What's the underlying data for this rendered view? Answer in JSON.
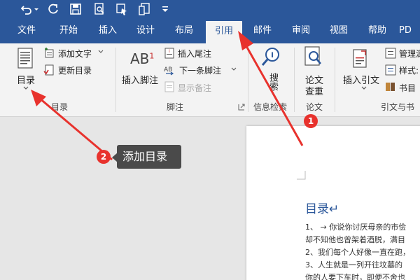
{
  "colors": {
    "ribbon_blue": "#2b579a",
    "ribbon_bg": "#f3f3f3",
    "arrow_red": "#e8322d",
    "tooltip_bg": "#4a4a4a"
  },
  "quick_access": {
    "icons": [
      "undo-icon",
      "dropdown-arrow-icon",
      "redo-icon",
      "save-icon",
      "print-preview-icon",
      "touch-mode-icon",
      "format-icon",
      "customize-icon"
    ]
  },
  "tabs": [
    {
      "label": "文件"
    },
    {
      "label": "开始"
    },
    {
      "label": "插入"
    },
    {
      "label": "设计"
    },
    {
      "label": "布局"
    },
    {
      "label": "引用"
    },
    {
      "label": "邮件"
    },
    {
      "label": "审阅"
    },
    {
      "label": "视图"
    },
    {
      "label": "帮助"
    },
    {
      "label": "PD"
    }
  ],
  "ribbon": {
    "toc_group": {
      "big_button": "目录",
      "add_text": "添加文字",
      "update_toc": "更新目录",
      "label": "目录"
    },
    "footnote_group": {
      "insert_footnote": "插入脚注",
      "insert_endnote": "插入尾注",
      "next_footnote": "下一条脚注",
      "show_notes": "显示备注",
      "label": "脚注"
    },
    "search_group": {
      "search": "搜索",
      "label": "信息检索"
    },
    "paper_group": {
      "paper_check_line1": "论文",
      "paper_check_line2": "查重",
      "label": "论文"
    },
    "citation_group": {
      "insert_citation": "插入引文",
      "manage_sources": "管理源",
      "style": "样式:",
      "bibliography": "书目",
      "label": "引文与书"
    }
  },
  "document": {
    "heading": "目录↵",
    "lines": [
      "1、 → 你说你讨厌母亲的市侩",
      "却不知他也曾架着酒脱，满目",
      "2、我们每个人好像一直在跑，",
      "3、人生就是一列开往坟墓的",
      "你的人要下车时，即便不舍也"
    ]
  },
  "annotations": {
    "badge1": "1",
    "badge2": "2",
    "tooltip": "添加目录"
  }
}
